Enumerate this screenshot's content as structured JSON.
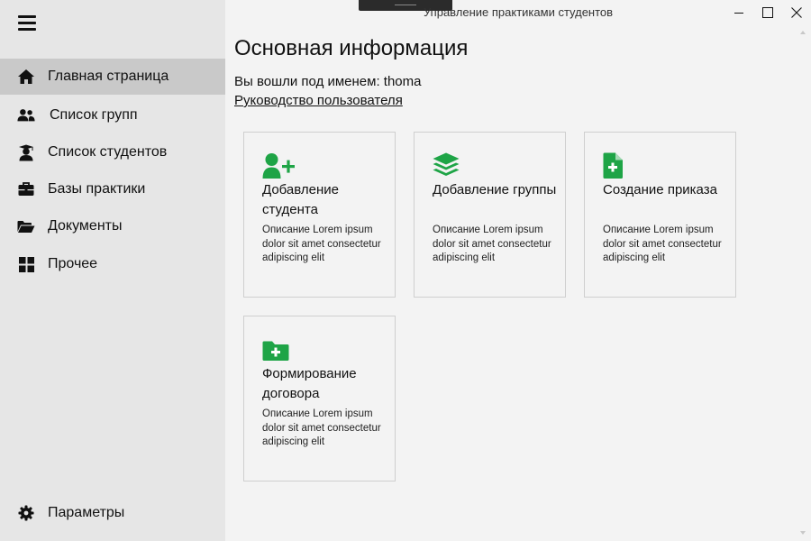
{
  "window": {
    "title": "Управление практиками студентов"
  },
  "sidebar": {
    "items": [
      {
        "label": "Главная страница",
        "icon": "home-icon"
      },
      {
        "label": "Список групп",
        "icon": "users-icon"
      },
      {
        "label": "Список студентов",
        "icon": "graduate-icon"
      },
      {
        "label": "Базы практики",
        "icon": "briefcase-icon"
      },
      {
        "label": "Документы",
        "icon": "folder-open-icon"
      },
      {
        "label": "Прочее",
        "icon": "grid-icon"
      }
    ],
    "settings": {
      "label": "Параметры",
      "icon": "gear-icon"
    }
  },
  "main": {
    "title": "Основная информация",
    "logged_in": "Вы вошли под именем: thoma",
    "guide_link": "Руководство пользователя",
    "cards": [
      {
        "title": "Добавление студента",
        "desc": "Описание Lorem ipsum dolor sit amet consectetur adipiscing elit",
        "icon": "user-plus-icon"
      },
      {
        "title": "Добавление группы",
        "desc": "Описание Lorem ipsum dolor sit amet consectetur adipiscing elit",
        "icon": "layers-icon"
      },
      {
        "title": "Создание приказа",
        "desc": "Описание Lorem ipsum dolor sit amet consectetur adipiscing elit",
        "icon": "file-plus-icon"
      },
      {
        "title": "Формирование договора",
        "desc": "Описание Lorem ipsum dolor sit amet consectetur adipiscing elit",
        "icon": "folder-plus-icon"
      }
    ]
  },
  "colors": {
    "accent": "#1ea446",
    "sidebar_bg": "#e6e6e6",
    "active_item_bg": "#c9c9c9",
    "content_bg": "#f3f3f3"
  }
}
